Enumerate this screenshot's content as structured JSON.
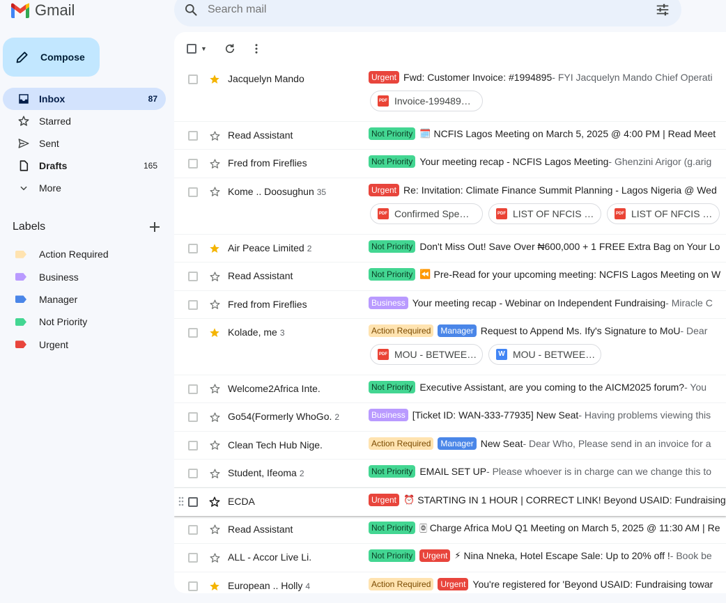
{
  "app": {
    "name": "Gmail"
  },
  "compose": {
    "label": "Compose"
  },
  "search": {
    "placeholder": "Search mail"
  },
  "nav": [
    {
      "label": "Inbox",
      "count": "87",
      "icon": "inbox-icon",
      "active": true,
      "bold": true
    },
    {
      "label": "Starred",
      "count": "",
      "icon": "star-icon",
      "active": false,
      "bold": false
    },
    {
      "label": "Sent",
      "count": "",
      "icon": "send-icon",
      "active": false,
      "bold": false
    },
    {
      "label": "Drafts",
      "count": "165",
      "icon": "draft-icon",
      "active": false,
      "bold": true
    },
    {
      "label": "More",
      "count": "",
      "icon": "chevron-down-icon",
      "active": false,
      "bold": false
    }
  ],
  "labels": {
    "title": "Labels",
    "items": [
      {
        "label": "Action Required",
        "color": "#ffe3b0"
      },
      {
        "label": "Business",
        "color": "#b99aff"
      },
      {
        "label": "Manager",
        "color": "#4a86e8"
      },
      {
        "label": "Not Priority",
        "color": "#43d692"
      },
      {
        "label": "Urgent",
        "color": "#e8453c"
      }
    ]
  },
  "emails": [
    {
      "sender": "Jacquelyn Mando",
      "count": "",
      "starred": true,
      "badges": [
        {
          "text": "Urgent",
          "type": "urgent"
        }
      ],
      "emoji": "",
      "subject": "Fwd: Customer Invoice: #1994895",
      "snippet": " - FYI Jacquelyn Mando Chief Operati",
      "attachments": [
        {
          "name": "Invoice-199489…",
          "type": "pdf"
        }
      ]
    },
    {
      "sender": "Read Assistant",
      "count": "",
      "starred": false,
      "badges": [
        {
          "text": "Not Priority",
          "type": "notp"
        }
      ],
      "emoji": "🗓️",
      "subject": "NCFIS Lagos Meeting on March 5, 2025 @ 4:00 PM | Read Meet",
      "snippet": "",
      "attachments": []
    },
    {
      "sender": "Fred from Fireflies",
      "count": "",
      "starred": false,
      "badges": [
        {
          "text": "Not Priority",
          "type": "notp"
        }
      ],
      "emoji": "",
      "subject": "Your meeting recap - NCFIS Lagos Meeting",
      "snippet": " - Ghenzini Arigor (g.arig",
      "attachments": []
    },
    {
      "sender": "Kome .. Doosughun",
      "count": "35",
      "starred": false,
      "badges": [
        {
          "text": "Urgent",
          "type": "urgent"
        }
      ],
      "emoji": "",
      "subject": "Re: Invitation: Climate Finance Summit Planning - Lagos Nigeria @ Wed",
      "snippet": "",
      "attachments": [
        {
          "name": "Confirmed Spe…",
          "type": "pdf"
        },
        {
          "name": "LIST OF NFCIS …",
          "type": "pdf"
        },
        {
          "name": "LIST OF NFCIS …",
          "type": "pdf"
        }
      ]
    },
    {
      "sender": "Air Peace Limited",
      "count": "2",
      "starred": true,
      "badges": [
        {
          "text": "Not Priority",
          "type": "notp"
        }
      ],
      "emoji": "",
      "subject": "Don't Miss Out! Save Over ₦600,000 + 1 FREE Extra Bag on Your Lo",
      "snippet": "",
      "attachments": []
    },
    {
      "sender": "Read Assistant",
      "count": "",
      "starred": false,
      "badges": [
        {
          "text": "Not Priority",
          "type": "notp"
        }
      ],
      "emoji": "⏪",
      "subject": "Pre-Read for your upcoming meeting: NCFIS Lagos Meeting on W",
      "snippet": "",
      "attachments": []
    },
    {
      "sender": "Fred from Fireflies",
      "count": "",
      "starred": false,
      "badges": [
        {
          "text": "Business",
          "type": "bus"
        }
      ],
      "emoji": "",
      "subject": "Your meeting recap - Webinar on Independent Fundraising",
      "snippet": " - Miracle C",
      "attachments": []
    },
    {
      "sender": "Kolade, me",
      "count": "3",
      "starred": true,
      "badges": [
        {
          "text": "Action Required",
          "type": "act"
        },
        {
          "text": "Manager",
          "type": "man"
        }
      ],
      "emoji": "",
      "subject": "Request to Append Ms. Ify's Signature to MoU",
      "snippet": " - Dear",
      "attachments": [
        {
          "name": "MOU - BETWEE…",
          "type": "pdf"
        },
        {
          "name": "MOU - BETWEE…",
          "type": "word"
        }
      ]
    },
    {
      "sender": "Welcome2Africa Inte.",
      "count": "",
      "starred": false,
      "badges": [
        {
          "text": "Not Priority",
          "type": "notp"
        }
      ],
      "emoji": "",
      "subject": "Executive Assistant,  are you coming to the AICM2025 forum?",
      "snippet": " - You",
      "attachments": []
    },
    {
      "sender": "Go54(Formerly WhoGo.",
      "count": "2",
      "starred": false,
      "badges": [
        {
          "text": "Business",
          "type": "bus"
        }
      ],
      "emoji": "",
      "subject": "[Ticket ID: WAN-333-77935] New Seat",
      "snippet": " - Having problems viewing this",
      "attachments": []
    },
    {
      "sender": "Clean Tech Hub Nige.",
      "count": "",
      "starred": false,
      "badges": [
        {
          "text": "Action Required",
          "type": "act"
        },
        {
          "text": "Manager",
          "type": "man"
        }
      ],
      "emoji": "",
      "subject": "New Seat",
      "snippet": " - Dear Who, Please send in an invoice for a",
      "attachments": []
    },
    {
      "sender": "Student, Ifeoma",
      "count": "2",
      "starred": false,
      "badges": [
        {
          "text": "Not Priority",
          "type": "notp"
        }
      ],
      "emoji": "",
      "subject": "EMAIL SET UP",
      "snippet": " - Please whoever is in charge can we change this to",
      "attachments": []
    },
    {
      "sender": "ECDA",
      "count": "",
      "starred": false,
      "hover": true,
      "badges": [
        {
          "text": "Urgent",
          "type": "urgent"
        }
      ],
      "emoji": "⏰",
      "subject": "STARTING IN 1 HOUR | CORRECT LINK! Beyond USAID: Fundraising to",
      "snippet": "",
      "attachments": []
    },
    {
      "sender": "Read Assistant",
      "count": "",
      "starred": false,
      "badges": [
        {
          "text": "Not Priority",
          "type": "notp"
        }
      ],
      "emoji": "🀙",
      "subject": "Charge Africa MoU Q1 Meeting on March 5, 2025 @ 11:30 AM | Re",
      "snippet": "",
      "attachments": []
    },
    {
      "sender": "ALL - Accor Live Li.",
      "count": "",
      "starred": false,
      "badges": [
        {
          "text": "Not Priority",
          "type": "notp"
        },
        {
          "text": "Urgent",
          "type": "urgent"
        }
      ],
      "emoji": "⚡",
      "subject": "Nina Nneka, Hotel Escape Sale: Up to 20% off !",
      "snippet": " - Book be",
      "attachments": []
    },
    {
      "sender": "European .. Holly",
      "count": "4",
      "starred": true,
      "badges": [
        {
          "text": "Action Required",
          "type": "act"
        },
        {
          "text": "Urgent",
          "type": "urgent"
        }
      ],
      "emoji": "",
      "subject": "You're registered for 'Beyond USAID: Fundraising towar",
      "snippet": "",
      "attachments": []
    }
  ]
}
